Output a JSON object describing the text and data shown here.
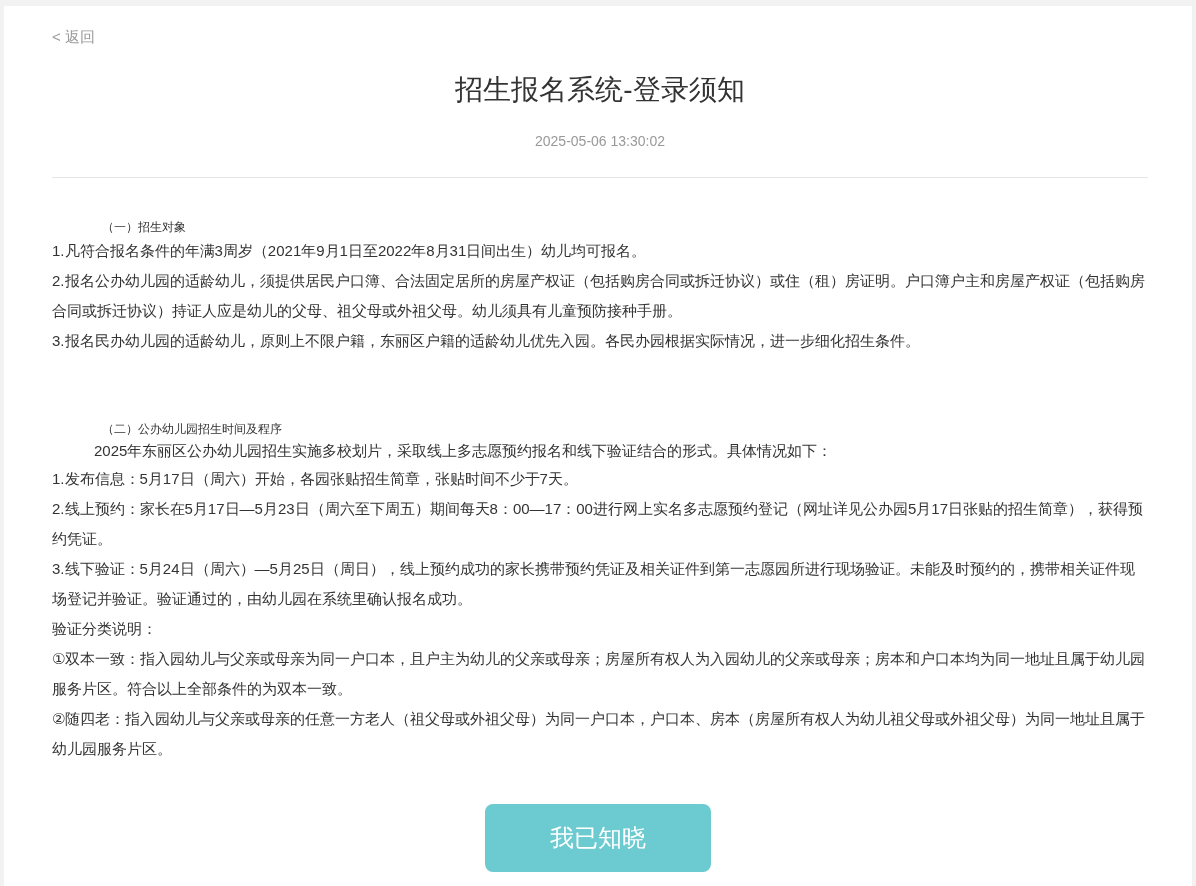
{
  "back_link": "< 返回",
  "title": "招生报名系统-登录须知",
  "date": "2025-05-06 13:30:02",
  "sections": [
    {
      "heading": "（一）招生对象",
      "paragraphs": [
        {
          "kind": "plain",
          "text": "1.凡符合报名条件的年满3周岁（2021年9月1日至2022年8月31日间出生）幼儿均可报名。"
        },
        {
          "kind": "plain",
          "text": "2.报名公办幼儿园的适龄幼儿，须提供居民户口簿、合法固定居所的房屋产权证（包括购房合同或拆迁协议）或住（租）房证明。户口簿户主和房屋产权证（包括购房合同或拆迁协议）持证人应是幼儿的父母、祖父母或外祖父母。幼儿须具有儿童预防接种手册。"
        },
        {
          "kind": "plain",
          "text": "3.报名民办幼儿园的适龄幼儿，原则上不限户籍，东丽区户籍的适龄幼儿优先入园。各民办园根据实际情况，进一步细化招生条件。"
        }
      ]
    },
    {
      "heading": "（二）公办幼儿园招生时间及程序",
      "paragraphs": [
        {
          "kind": "indent",
          "text": "2025年东丽区公办幼儿园招生实施多校划片，采取线上多志愿预约报名和线下验证结合的形式。具体情况如下："
        },
        {
          "kind": "plain",
          "text": "1.发布信息：5月17日（周六）开始，各园张贴招生简章，张贴时间不少于7天。"
        },
        {
          "kind": "plain",
          "text": "2.线上预约：家长在5月17日—5月23日（周六至下周五）期间每天8：00—17：00进行网上实名多志愿预约登记（网址详见公办园5月17日张贴的招生简章），获得预约凭证。"
        },
        {
          "kind": "plain",
          "text": "3.线下验证：5月24日（周六）—5月25日（周日），线上预约成功的家长携带预约凭证及相关证件到第一志愿园所进行现场验证。未能及时预约的，携带相关证件现场登记并验证。验证通过的，由幼儿园在系统里确认报名成功。"
        },
        {
          "kind": "plain",
          "text": "验证分类说明："
        },
        {
          "kind": "plain",
          "text": "①双本一致：指入园幼儿与父亲或母亲为同一户口本，且户主为幼儿的父亲或母亲；房屋所有权人为入园幼儿的父亲或母亲；房本和户口本均为同一地址且属于幼儿园服务片区。符合以上全部条件的为双本一致。"
        },
        {
          "kind": "plain",
          "text": "②随四老：指入园幼儿与父亲或母亲的任意一方老人（祖父母或外祖父母）为同一户口本，户口本、房本（房屋所有权人为幼儿祖父母或外祖父母）为同一地址且属于幼儿园服务片区。"
        }
      ]
    }
  ],
  "confirm_button": "我已知晓"
}
